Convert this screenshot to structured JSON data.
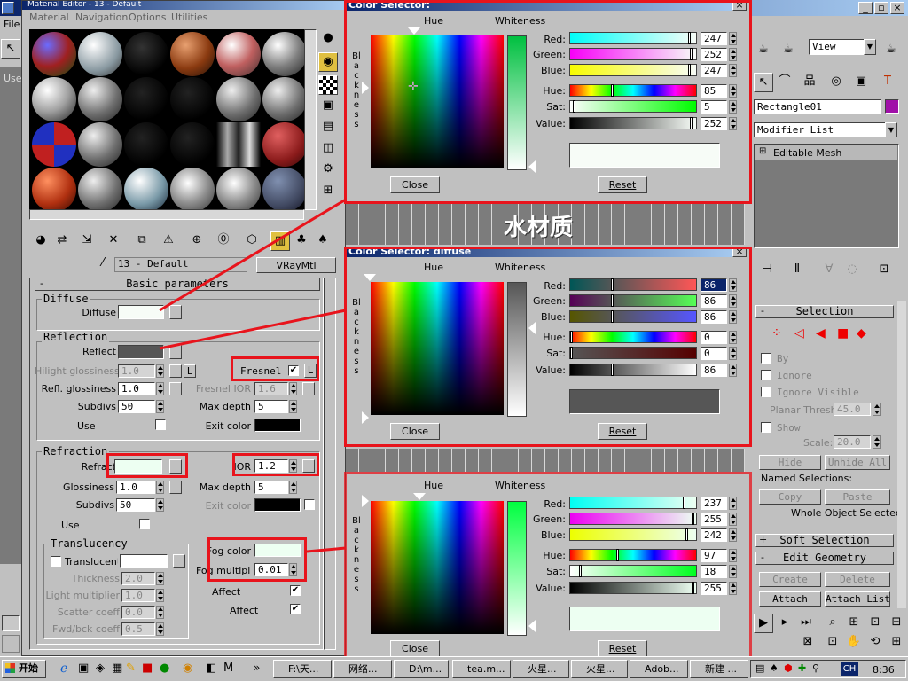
{
  "app": {
    "menu_file": "File",
    "viewport_label": "Use"
  },
  "me": {
    "title": "Material Editor - 13 - Default",
    "menu": [
      "Material",
      "Navigation",
      "Options",
      "Utilities"
    ],
    "material_name": "13 - Default",
    "material_type": "VRayMtl",
    "rollout": "Basic parameters",
    "diffuse": {
      "group": "Diffuse",
      "label": "Diffuse",
      "color": "#f7fcf7"
    },
    "reflection": {
      "group": "Reflection",
      "reflect_label": "Reflect",
      "reflect_color": "#565656",
      "hilight_label": "Hilight glossiness",
      "hilight_value": "1.0",
      "l_btn": "L",
      "fresnel_label": "Fresnel",
      "fresnel_l": "L",
      "refl_gloss_label": "Refl. glossiness",
      "refl_gloss_value": "1.0",
      "fresnel_ior_label": "Fresnel IOR",
      "fresnel_ior_value": "1.6",
      "subdivs_label": "Subdivs",
      "subdivs_value": "50",
      "maxdepth_label": "Max depth",
      "maxdepth_value": "5",
      "use_label": "Use",
      "exit_label": "Exit color"
    },
    "refraction": {
      "group": "Refraction",
      "refract_label": "Refract",
      "refract_color": "#edfff2",
      "ior_label": "IOR",
      "ior_value": "1.2",
      "gloss_label": "Glossiness",
      "gloss_value": "1.0",
      "maxdepth_label": "Max depth",
      "maxdepth_value": "5",
      "subdivs_label": "Subdivs",
      "subdivs_value": "50",
      "exit_label": "Exit color",
      "use_label": "Use"
    },
    "translucency": {
      "group": "Translucency",
      "label": "Translucent",
      "thickness_label": "Thickness",
      "thickness_value": "2.0",
      "light_mult_label": "Light multiplier",
      "light_mult_value": "1.0",
      "scatter_label": "Scatter coeff",
      "scatter_value": "0.0",
      "fwd_label": "Fwd/bck coeff",
      "fwd_value": "0.5"
    },
    "fog": {
      "color_label": "Fog color",
      "color": "#edfff2",
      "mult_label": "Fog multiplier",
      "mult_value": "0.01"
    },
    "affect1": "Affect",
    "affect2": "Affect"
  },
  "color_selectors": [
    {
      "title": "Color Selector:",
      "hue_label": "Hue",
      "whiteness_label": "Whiteness",
      "blackness_label": "Blackness",
      "red_label": "Red:",
      "green_label": "Green:",
      "blue_label": "Blue:",
      "hue2_label": "Hue:",
      "sat_label": "Sat:",
      "value_label": "Value:",
      "red": 247,
      "green": 252,
      "blue": 247,
      "hue": 85,
      "sat": 5,
      "value": 252,
      "swatch": "#f7fcf7",
      "close": "Close",
      "reset": "Reset"
    },
    {
      "title": "Color Selector: diffuse",
      "hue_label": "Hue",
      "whiteness_label": "Whiteness",
      "blackness_label": "Blackness",
      "red_label": "Red:",
      "green_label": "Green:",
      "blue_label": "Blue:",
      "hue2_label": "Hue:",
      "sat_label": "Sat:",
      "value_label": "Value:",
      "red": 86,
      "green": 86,
      "blue": 86,
      "hue": 0,
      "sat": 0,
      "value": 86,
      "swatch": "#565656",
      "close": "Close",
      "reset": "Reset"
    },
    {
      "title": "",
      "hue_label": "Hue",
      "whiteness_label": "Whiteness",
      "blackness_label": "Blackness",
      "red_label": "Red:",
      "green_label": "Green:",
      "blue_label": "Blue:",
      "hue2_label": "Hue:",
      "sat_label": "Sat:",
      "value_label": "Value:",
      "red": 237,
      "green": 255,
      "blue": 242,
      "hue": 97,
      "sat": 18,
      "value": 255,
      "swatch": "#edfff2",
      "close": "Close",
      "reset": "Reset"
    }
  ],
  "viewport": {
    "caption": "水材质"
  },
  "cmd": {
    "view_select": "View",
    "object_name": "Rectangle01",
    "modifier_list": "Modifier List",
    "stack_item": "Editable Mesh",
    "selection_title": "Selection",
    "by": "By",
    "ignore": "Ignore",
    "ignore_visible": "Ignore Visible",
    "planar_label": "Planar Thresh:",
    "planar_value": "45.0",
    "show": "Show",
    "scale_label": "Scale:",
    "scale_value": "20.0",
    "hide": "Hide",
    "unhide_all": "Unhide All",
    "named_sel": "Named Selections:",
    "copy": "Copy",
    "paste": "Paste",
    "whole_obj": "Whole Object Selected",
    "soft_sel": "Soft Selection",
    "edit_geom": "Edit Geometry",
    "create": "Create",
    "delete": "Delete",
    "attach": "Attach",
    "attach_list": "Attach List"
  },
  "taskbar": {
    "start": "开始",
    "items": [
      "F:\\天...",
      "网络...",
      "D:\\m...",
      "tea.m...",
      "火星...",
      "火星...",
      "Adob...",
      "新建 ..."
    ],
    "tray_ch": "CH",
    "clock": "8:36"
  }
}
